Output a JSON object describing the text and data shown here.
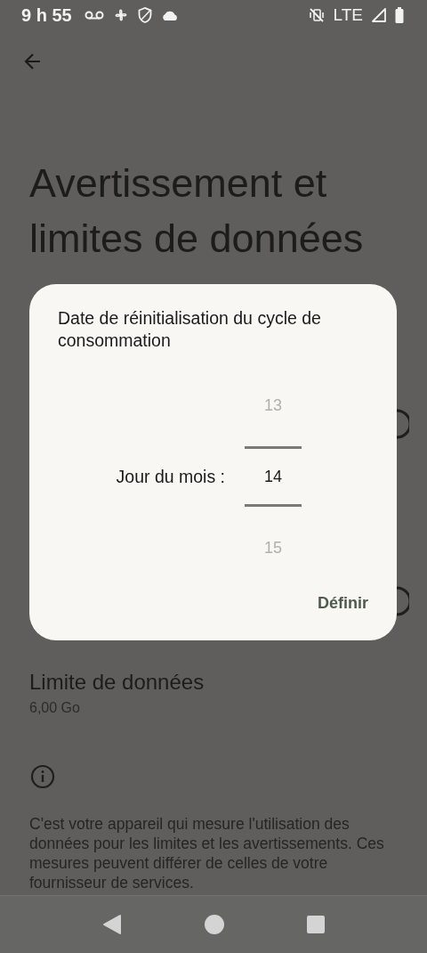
{
  "status_bar": {
    "time": "9 h 55",
    "network": "LTE"
  },
  "page": {
    "title": "Avertissement et limites de données",
    "items": [
      {
        "title": "Limite de données",
        "subtitle": "6,00 Go"
      }
    ],
    "footer": "C'est votre appareil qui mesure l'utilisation des données pour les limites et les avertissements. Ces mesures peuvent différer de celles de votre fournisseur de services."
  },
  "dialog": {
    "title": "Date de réinitialisation du cycle de consommation",
    "label": "Jour du mois :",
    "picker": [
      {
        "value": "13",
        "selected": false
      },
      {
        "value": "14",
        "selected": true
      },
      {
        "value": "15",
        "selected": false
      }
    ],
    "button": "Définir"
  }
}
